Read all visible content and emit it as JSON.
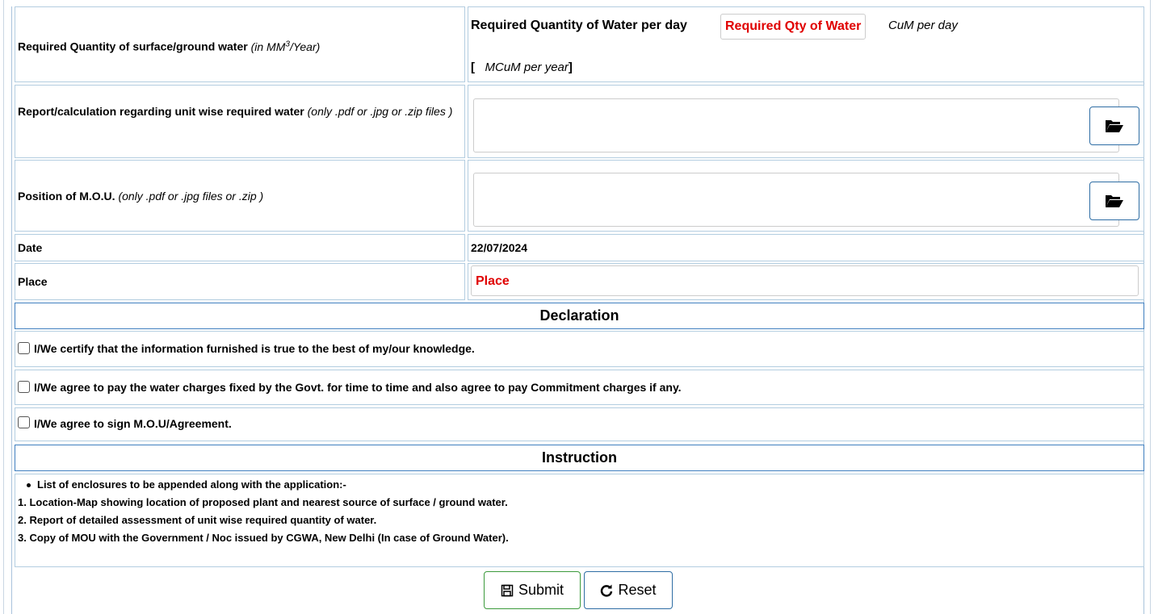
{
  "rows": {
    "water_qty": {
      "label": "Required Quantity of surface/ground water",
      "unit_prefix": "(in MM",
      "unit_sup": "3",
      "unit_suffix": "/Year)",
      "per_day_label": "Required Quantity of Water per day",
      "per_day_placeholder": "Required Qty of Water",
      "per_day_unit": "CuM per day",
      "bracket_open": "[",
      "per_year_unit": "MCuM per year",
      "bracket_close": "]"
    },
    "report": {
      "label": "Report/calculation regarding unit wise required water",
      "hint": "(only .pdf or .jpg or .zip files )"
    },
    "mou": {
      "label": "Position of M.O.U.",
      "hint": "(only .pdf or .jpg files or .zip )"
    },
    "date": {
      "label": "Date",
      "value": "22/07/2024"
    },
    "place": {
      "label": "Place",
      "placeholder": "Place"
    }
  },
  "declaration": {
    "title": "Declaration",
    "items": [
      "I/We certify that the information furnished is true to the best of my/our knowledge.",
      "I/We agree to pay the water charges fixed by the Govt. for time to time and also agree to pay Commitment charges if any.",
      "I/We agree to sign M.O.U/Agreement."
    ]
  },
  "instruction": {
    "title": "Instruction",
    "bullet": "List of enclosures to be appended along with the application:-",
    "items": [
      "1. Location-Map showing location of proposed plant and nearest source of surface / ground water.",
      "2. Report of detailed assessment of unit wise required quantity of water.",
      "3. Copy of MOU with the Government / Noc issued by CGWA, New Delhi (In case of Ground Water)."
    ]
  },
  "buttons": {
    "submit": "Submit",
    "reset": "Reset"
  },
  "icons": {
    "browse": "folder-open-icon",
    "submit": "floppy-disk-icon",
    "reset": "refresh-icon"
  },
  "colors": {
    "placeholder_red": "#e00000",
    "header_border": "#3f7fbf",
    "cell_border": "#b3cde0",
    "submit_border": "#3c9a3c",
    "reset_border": "#2e6da4"
  }
}
